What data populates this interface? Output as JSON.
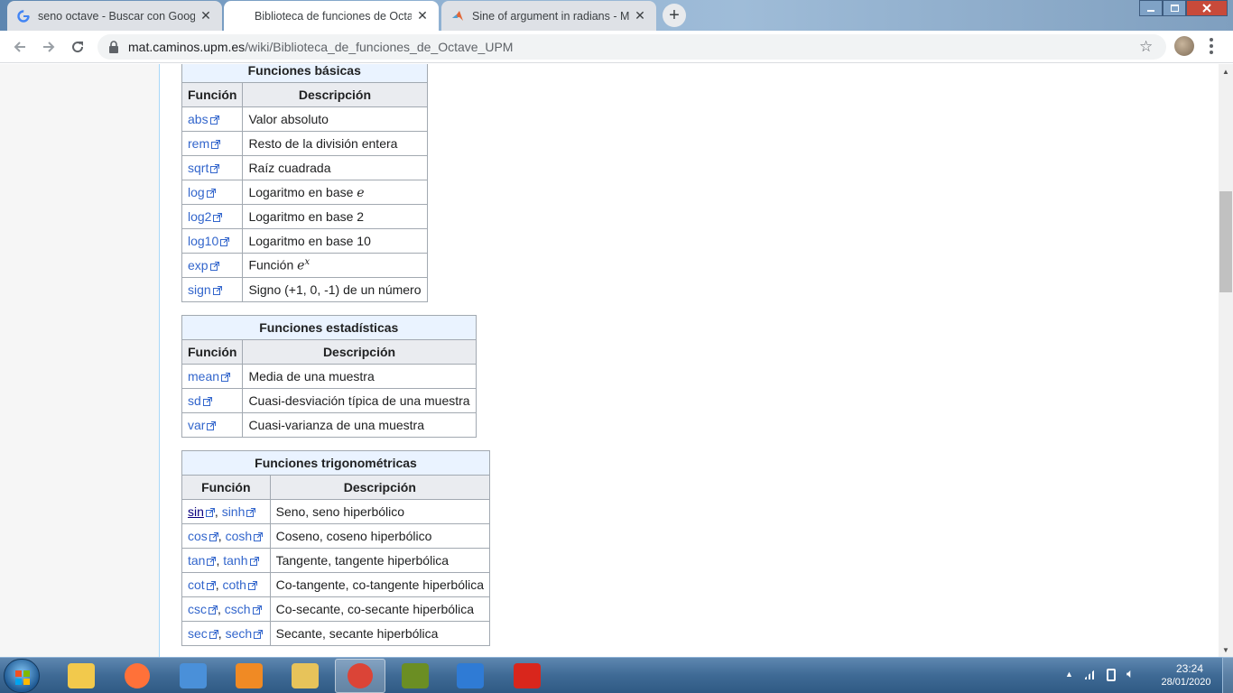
{
  "browser": {
    "tabs": [
      {
        "title": "seno octave - Buscar con Google",
        "favicon": "google-icon",
        "active": false
      },
      {
        "title": "Biblioteca de funciones de Octave",
        "favicon": "none",
        "active": true
      },
      {
        "title": "Sine of argument in radians - MA",
        "favicon": "matlab-icon",
        "active": false
      }
    ],
    "close_glyph": "✕",
    "new_tab_glyph": "+",
    "url_host": "mat.caminos.upm.es",
    "url_path": "/wiki/Biblioteca_de_funciones_de_Octave_UPM"
  },
  "tables": {
    "basic": {
      "caption": "Funciones básicas",
      "col1": "Función",
      "col2": "Descripción",
      "rows": [
        {
          "fn": "abs",
          "desc": "Valor absoluto"
        },
        {
          "fn": "rem",
          "desc": "Resto de la división entera"
        },
        {
          "fn": "sqrt",
          "desc": "Raíz cuadrada"
        },
        {
          "fn": "log",
          "desc": "Logaritmo en base ",
          "math": "e"
        },
        {
          "fn": "log2",
          "desc": "Logaritmo en base 2"
        },
        {
          "fn": "log10",
          "desc": "Logaritmo en base 10"
        },
        {
          "fn": "exp",
          "desc": "Función ",
          "math": "e",
          "sup": "x"
        },
        {
          "fn": "sign",
          "desc": "Signo (+1, 0, -1) de un número"
        }
      ]
    },
    "stats": {
      "caption": "Funciones estadísticas",
      "col1": "Función",
      "col2": "Descripción",
      "rows": [
        {
          "fn": "mean",
          "desc": "Media de una muestra"
        },
        {
          "fn": "sd",
          "desc": "Cuasi-desviación típica de una muestra"
        },
        {
          "fn": "var",
          "desc": "Cuasi-varianza de una muestra"
        }
      ]
    },
    "trig": {
      "caption": "Funciones trigonométricas",
      "col1": "Función",
      "col2": "Descripción",
      "rows": [
        {
          "fn": "sin",
          "fnh": "sinh",
          "desc": "Seno, seno hiperbólico"
        },
        {
          "fn": "cos",
          "fnh": "cosh",
          "desc": "Coseno, coseno hiperbólico"
        },
        {
          "fn": "tan",
          "fnh": "tanh",
          "desc": "Tangente, tangente hiperbólica"
        },
        {
          "fn": "cot",
          "fnh": "coth",
          "desc": "Co-tangente, co-tangente hiperbólica"
        },
        {
          "fn": "csc",
          "fnh": "csch",
          "desc": "Co-secante, co-secante hiperbólica"
        },
        {
          "fn": "sec",
          "fnh": "sech",
          "desc": "Secante, secante hiperbólica"
        }
      ]
    }
  },
  "taskbar": {
    "apps": [
      "windows-explorer-icon",
      "firefox-icon",
      "control-panel-icon",
      "media-player-icon",
      "file-manager-icon",
      "chrome-icon",
      "octave-icon",
      "outlook-icon",
      "acrobat-icon"
    ],
    "time": "23:24",
    "date": "28/01/2020"
  },
  "colors": {
    "link": "#3366cc",
    "table_header": "#eaecf0",
    "caption_bg": "#eaf3ff",
    "border": "#a2a9b1"
  }
}
